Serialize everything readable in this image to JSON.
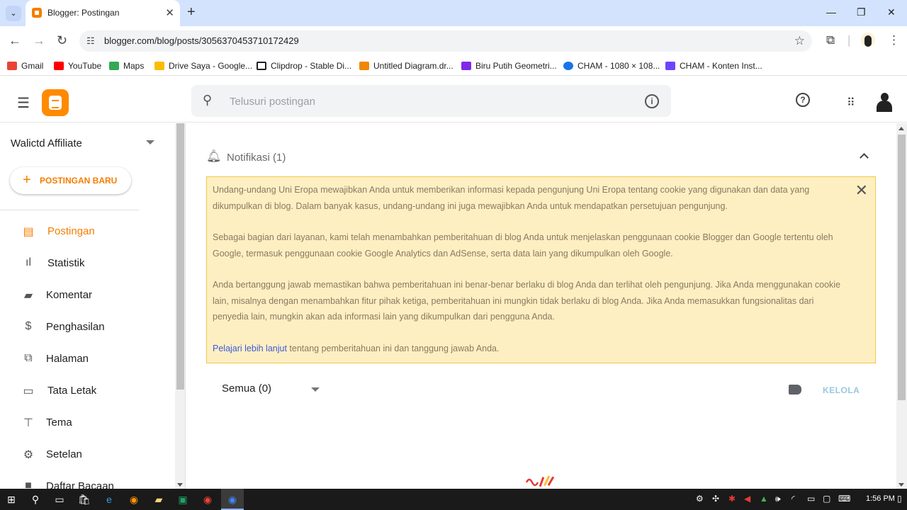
{
  "browser": {
    "tab_title": "Blogger: Postingan",
    "url": "blogger.com/blog/posts/3056370453710172429",
    "bookmarks": [
      {
        "label": "Gmail",
        "color": "#ea4335"
      },
      {
        "label": "YouTube",
        "color": "#ff0000"
      },
      {
        "label": "Maps",
        "color": "#34a853"
      },
      {
        "label": "Drive Saya - Google...",
        "color": "#fbbc04"
      },
      {
        "label": "Clipdrop - Stable Di...",
        "color": "#202124"
      },
      {
        "label": "Untitled Diagram.dr...",
        "color": "#f08705"
      },
      {
        "label": "Biru Putih Geometri...",
        "color": "#7d2ae8"
      },
      {
        "label": "CHAM - 1080 × 108...",
        "color": "#1a73e8"
      },
      {
        "label": "CHAM - Konten Inst...",
        "color": "#6e44ff"
      }
    ]
  },
  "header": {
    "search_placeholder": "Telusuri postingan"
  },
  "sidebar": {
    "blog_name": "Walictd Affiliate",
    "new_post_label": "POSTINGAN BARU",
    "items": [
      {
        "label": "Postingan",
        "icon": "posts-icon",
        "active": true
      },
      {
        "label": "Statistik",
        "icon": "stats-icon"
      },
      {
        "label": "Komentar",
        "icon": "comment-icon"
      },
      {
        "label": "Penghasilan",
        "icon": "dollar-icon"
      },
      {
        "label": "Halaman",
        "icon": "pages-icon"
      },
      {
        "label": "Tata Letak",
        "icon": "layout-icon"
      },
      {
        "label": "Tema",
        "icon": "theme-icon"
      },
      {
        "label": "Setelan",
        "icon": "gear-icon"
      },
      {
        "label": "Daftar Bacaan",
        "icon": "reading-list-icon"
      }
    ]
  },
  "main": {
    "notif_title": "Notifikasi (1)",
    "notif_p1": "Undang-undang Uni Eropa mewajibkan Anda untuk memberikan informasi kepada pengunjung Uni Eropa tentang cookie yang digunakan dan data yang dikumpulkan di blog. Dalam banyak kasus, undang-undang ini juga mewajibkan Anda untuk mendapatkan persetujuan pengunjung.",
    "notif_p2": "Sebagai bagian dari layanan, kami telah menambahkan pemberitahuan di blog Anda untuk menjelaskan penggunaan cookie Blogger dan Google tertentu oleh Google, termasuk penggunaan cookie Google Analytics dan AdSense, serta data lain yang dikumpulkan oleh Google.",
    "notif_p3": "Anda bertanggung jawab memastikan bahwa pemberitahuan ini benar-benar berlaku di blog Anda dan terlihat oleh pengunjung. Jika Anda menggunakan cookie lain, misalnya dengan menambahkan fitur pihak ketiga, pemberitahuan ini mungkin tidak berlaku di blog Anda. Jika Anda memasukkan fungsionalitas dari penyedia lain, mungkin akan ada informasi lain yang dikumpulkan dari pengguna Anda.",
    "notif_link": "Pelajari lebih lanjut",
    "notif_p4_rest": " tentang pemberitahuan ini dan tanggung jawab Anda.",
    "filter_label": "Semua (0)",
    "manage_label": "KELOLA"
  },
  "taskbar": {
    "time": "1:56 PM"
  }
}
